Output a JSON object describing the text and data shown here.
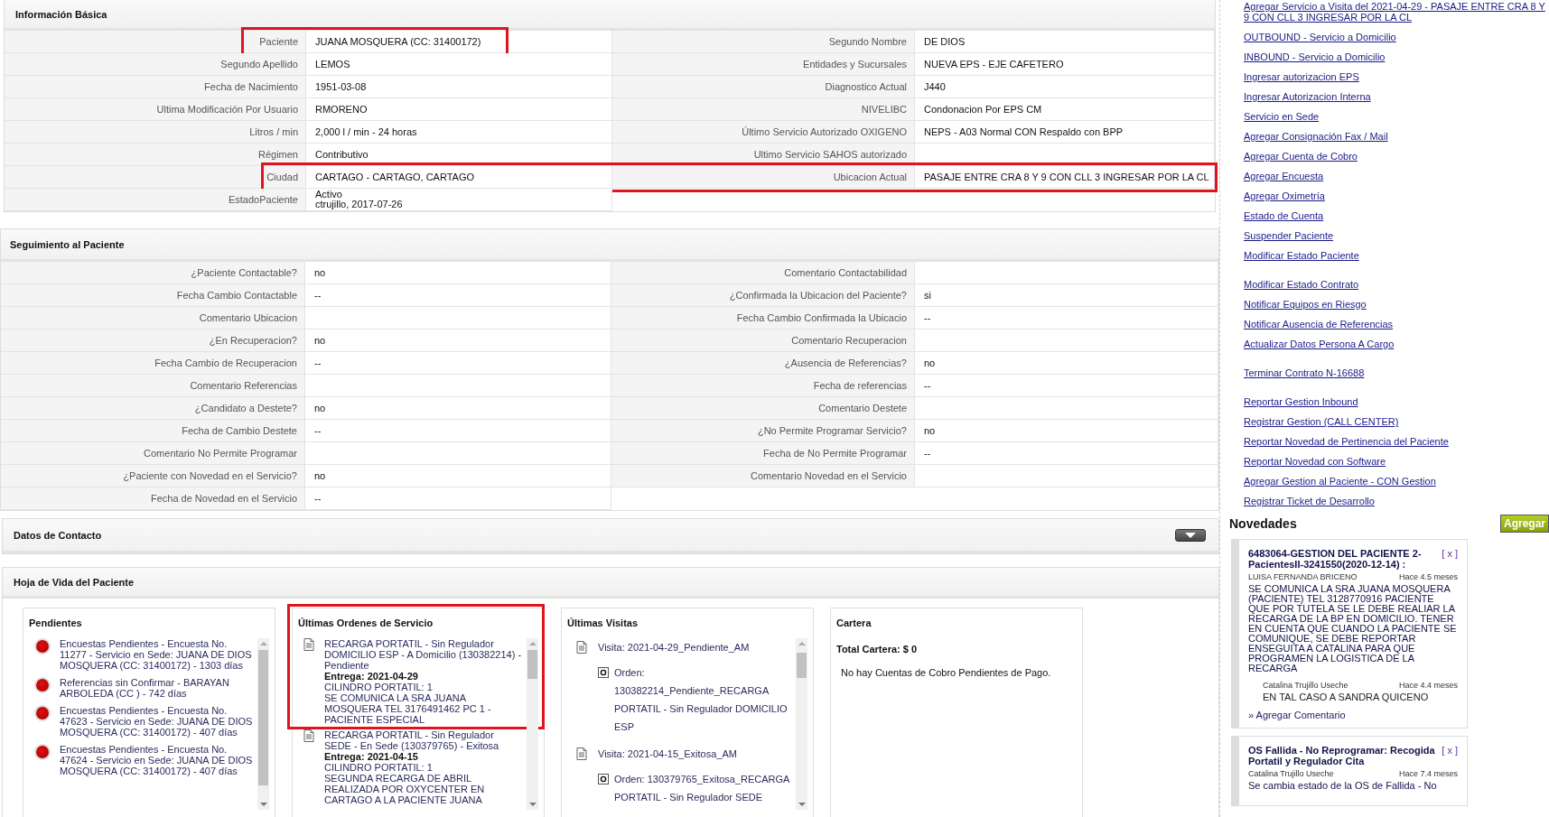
{
  "info": {
    "title": "Información Básica",
    "rows": [
      {
        "left": {
          "label": "Paciente",
          "value": "JUANA MOSQUERA (CC: 31400172)",
          "highlighted": true
        },
        "right": {
          "label": "Segundo Nombre",
          "value": "DE DIOS",
          "highlighted": false
        }
      },
      {
        "left": {
          "label": "Segundo Apellido",
          "value": "LEMOS",
          "highlighted": false
        },
        "right": {
          "label": "Entidades y Sucursales",
          "value": "NUEVA EPS - EJE CAFETERO",
          "highlighted": false
        }
      },
      {
        "left": {
          "label": "Fecha de Nacimiento",
          "value": "1951-03-08",
          "highlighted": false
        },
        "right": {
          "label": "Diagnostico Actual",
          "value": "J440",
          "highlighted": false
        }
      },
      {
        "left": {
          "label": "Ultima Modificación Por Usuario",
          "value": "RMORENO",
          "highlighted": false
        },
        "right": {
          "label": "NIVELIBC",
          "value": "Condonacion Por EPS CM",
          "highlighted": false
        }
      },
      {
        "left": {
          "label": "Litros / min",
          "value": "2,000 l / min - 24 horas",
          "highlighted": false
        },
        "right": {
          "label": "Último Servicio Autorizado OXIGENO",
          "value": "NEPS - A03 Normal CON Respaldo con BPP",
          "highlighted": false
        }
      },
      {
        "left": {
          "label": "Régimen",
          "value": "Contributivo",
          "highlighted": false
        },
        "right": {
          "label": "Ultimo Servicio SAHOS autorizado",
          "highlighted": false
        }
      },
      {
        "left": {
          "label": "Ciudad",
          "value": "CARTAGO - CARTAGO, CARTAGO",
          "highlighted": true
        },
        "right": {
          "label": "Ubicacion Actual",
          "value": "PASAJE ENTRE CRA 8 Y 9 CON CLL 3 INGRESAR POR LA CL",
          "highlighted": true
        }
      },
      {
        "left": {
          "label": "EstadoPaciente",
          "value": "Activo\nctrujillo, 2017-07-26",
          "highlighted": false
        }
      }
    ]
  },
  "seguimiento": {
    "title": "Seguimiento al Paciente",
    "rows": [
      {
        "left": {
          "label": "¿Paciente Contactable?",
          "value": "no"
        },
        "right": {
          "label": "Comentario Contactabilidad"
        }
      },
      {
        "left": {
          "label": "Fecha Cambio Contactable",
          "value": "--"
        },
        "right": {
          "label": "¿Confirmada la Ubicacion del Paciente?",
          "value": "si"
        }
      },
      {
        "left": {
          "label": "Comentario Ubicacion"
        },
        "right": {
          "label": "Fecha Cambio Confirmada la Ubicacio",
          "value": "--"
        }
      },
      {
        "left": {
          "label": "¿En Recuperacion?",
          "value": "no"
        },
        "right": {
          "label": "Comentario Recuperacion"
        }
      },
      {
        "left": {
          "label": "Fecha Cambio de Recuperacion",
          "value": "--"
        },
        "right": {
          "label": "¿Ausencia de Referencias?",
          "value": "no"
        }
      },
      {
        "left": {
          "label": "Comentario Referencias"
        },
        "right": {
          "label": "Fecha de referencias",
          "value": "--"
        }
      },
      {
        "left": {
          "label": "¿Candidato a Destete?",
          "value": "no"
        },
        "right": {
          "label": "Comentario Destete"
        }
      },
      {
        "left": {
          "label": "Fecha de Cambio Destete",
          "value": "--"
        },
        "right": {
          "label": "¿No Permite Programar Servicio?",
          "value": "no"
        }
      },
      {
        "left": {
          "label": "Comentario No Permite Programar"
        },
        "right": {
          "label": "Fecha de No Permite Programar",
          "value": "--"
        }
      },
      {
        "left": {
          "label": "¿Paciente con Novedad en el Servicio?",
          "value": "no"
        },
        "right": {
          "label": "Comentario Novedad en el Servicio"
        }
      },
      {
        "left": {
          "label": "Fecha de Novedad en el Servicio",
          "value": "--"
        }
      }
    ]
  },
  "contacto": {
    "title": "Datos de Contacto"
  },
  "hoja": {
    "title": "Hoja de Vida del Paciente",
    "pendientes": {
      "title": "Pendientes",
      "items": [
        "Encuestas Pendientes - Encuesta No. 11277 - Servicio en Sede: JUANA DE DIOS MOSQUERA (CC: 31400172) - 1303 días",
        "Referencias sin Confirmar - BARAYAN ARBOLEDA (CC ) - 742 días",
        "Encuestas Pendientes - Encuesta No. 47623 - Servicio en Sede: JUANA DE DIOS MOSQUERA (CC: 31400172) - 407 días",
        "Encuestas Pendientes - Encuesta No. 47624 - Servicio en Sede: JUANA DE DIOS MOSQUERA (CC: 31400172) - 407 días"
      ]
    },
    "ordenes": {
      "title": "Últimas Ordenes de Servicio",
      "items": [
        {
          "title": "RECARGA PORTATIL - Sin Regulador DOMICILIO ESP - A Domicilio (130382214) - Pendiente",
          "delivery": "Entrega: 2021-04-29",
          "lines": [
            "CILINDRO PORTATIL: 1",
            "SE COMUNICA LA SRA JUANA MOSQUERA TEL 3176491462 PC 1 - PACIENTE ESPECIAL"
          ],
          "highlighted": true
        },
        {
          "title": "RECARGA PORTATIL - Sin Regulador SEDE - En Sede (130379765) - Exitosa",
          "delivery": "Entrega: 2021-04-15",
          "lines": [
            "CILINDRO PORTATIL: 1",
            "SEGUNDA RECARGA DE ABRIL REALIZADA POR OXYCENTER EN CARTAGO A LA PACIENTE JUANA"
          ],
          "highlighted": false
        }
      ]
    },
    "visitas": {
      "title": "Últimas Visitas",
      "items": [
        {
          "title": "Visita: 2021-04-29_Pendiente_AM",
          "orders": [
            "Orden: 130382214_Pendiente_RECARGA PORTATIL - Sin Regulador DOMICILIO ESP"
          ]
        },
        {
          "title": "Visita: 2021-04-15_Exitosa_AM",
          "orders": [
            "Orden: 130379765_Exitosa_RECARGA PORTATIL - Sin Regulador SEDE"
          ]
        }
      ]
    },
    "cartera": {
      "title": "Cartera",
      "total": "Total Cartera: $ 0",
      "note": "No hay Cuentas de Cobro Pendientes de Pago."
    }
  },
  "sidebar": {
    "link_groups": [
      {
        "links": [
          "Agregar Servicio a Visita del 2021-04-29 - PASAJE ENTRE CRA 8 Y 9 CON CLL 3 INGRESAR POR LA CL",
          "OUTBOUND - Servicio a Domicilio",
          "INBOUND - Servicio a Domicilio",
          "Ingresar autorizacion EPS",
          "Ingresar Autorizacion Interna",
          "Servicio en Sede",
          "Agregar Consignación Fax / Mail",
          "Agregar Cuenta de Cobro",
          "Agregar Encuesta",
          "Agregar Oximetría",
          "Estado de Cuenta",
          "Suspender Paciente",
          "Modificar Estado Paciente"
        ]
      },
      {
        "links": [
          "Modificar Estado Contrato",
          "Notificar Equipos en Riesgo",
          "Notificar Ausencia de Referencias",
          "Actualizar Datos Persona A Cargo"
        ]
      },
      {
        "links": [
          "Terminar Contrato N-16688"
        ]
      },
      {
        "links": [
          "Reportar Gestion Inbound",
          "Registrar Gestion (CALL CENTER)",
          "Reportar Novedad de Pertinencia del Paciente",
          "Reportar Novedad con Software",
          "Agregar Gestion al Paciente - CON Gestion",
          "Registrar Ticket de Desarrollo"
        ]
      }
    ]
  },
  "novedades": {
    "title": "Novedades",
    "add_button": "Agregar",
    "cards": [
      {
        "title": "6483064-GESTION DEL PACIENTE 2-PacientesII-3241550(2020-12-14) :",
        "close": "[ x ]",
        "author": "LUISA FERNANDA BRICENO",
        "age": "Hace 4.5 meses",
        "body": "SE COMUNICA LA SRA JUANA MOSQUERA (PACIENTE) TEL 3128770916 PACIENTE QUE POR TUTELA SE LE DEBE REALIAR LA RECARGA DE LA BP EN DOMICILIO. TENER EN CUENTA QUE CUANDO LA PACIENTE SE COMUNIQUE, SE DEBE REPORTAR ENSEGUITA A CATALINA PARA QUE PROGRAMEN LA LOGISTICA DE LA RECARGA",
        "comments": [
          {
            "author": "Catalina Trujillo Useche",
            "age": "Hace 4.4 meses",
            "body": "EN TAL CASO A SANDRA QUICENO"
          }
        ],
        "add_comment": "» Agregar Comentario"
      },
      {
        "title": "OS Fallida - No Reprogramar: Recogida Portatil y Regulador Cita",
        "close": "[ x ]",
        "author": "Catalina Trujillo Useche",
        "age": "Hace 7.4 meses",
        "body": "Se cambia estado de la OS de Fallida - No"
      }
    ]
  }
}
